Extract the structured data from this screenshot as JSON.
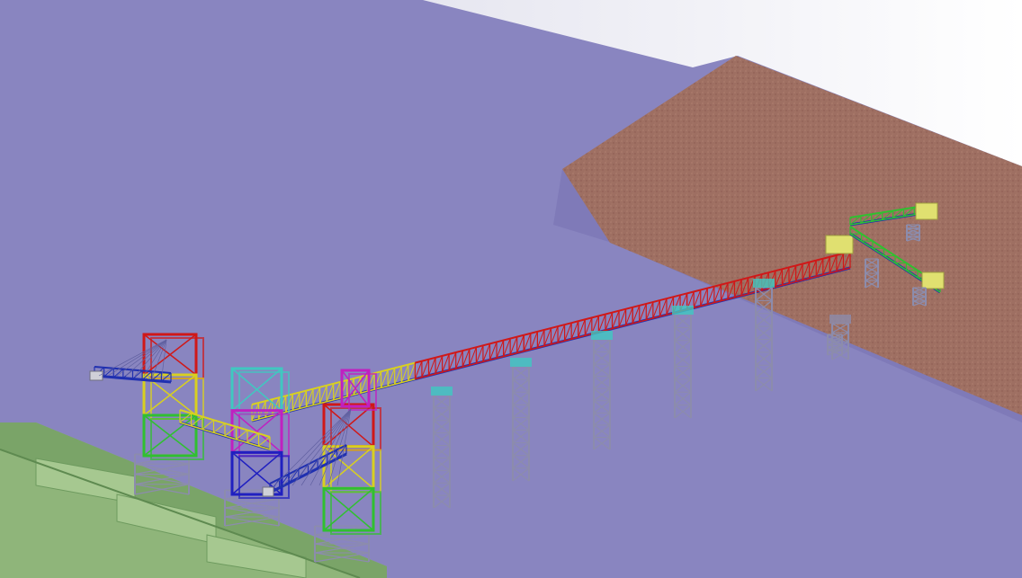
{
  "scene": {
    "description_name": "conveyor-barge-loading-3d-model",
    "colors": {
      "water": "#8985c0",
      "water_light": "#9592c9",
      "sky": "#f4f4f8",
      "bank_top": "#9e6f62",
      "bank_side": "#8f5f55",
      "wharf": "#8fb57a",
      "wharf_dark": "#6d9a5e",
      "truss_red": "#d01818",
      "truss_yellow": "#d8d020",
      "truss_cyan": "#40c8c0",
      "truss_green": "#30c030",
      "truss_magenta": "#c020c0",
      "truss_blue": "#2020c0",
      "pier_gray": "#8c8cac",
      "belt_blue": "#2030b0",
      "hopper": "#e0e070"
    }
  }
}
